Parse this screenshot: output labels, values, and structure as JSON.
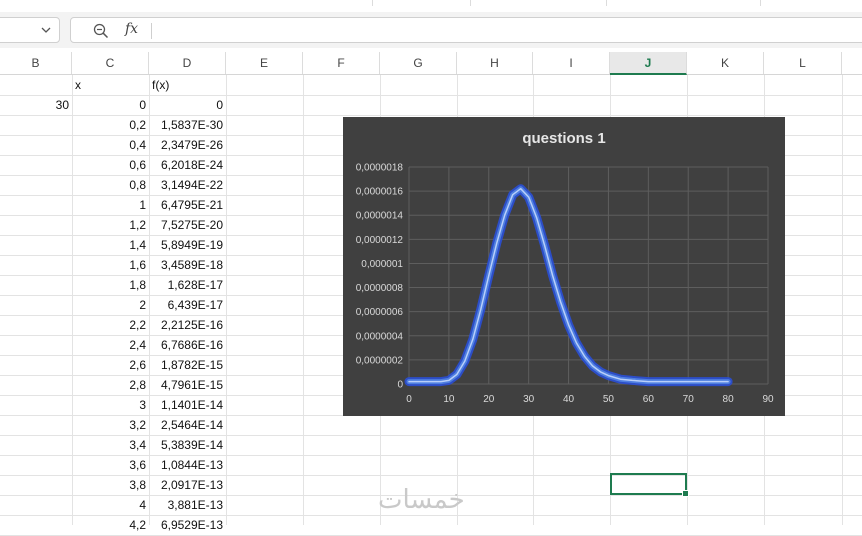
{
  "toolbar": {
    "name_box_value": "",
    "formula_value": "",
    "zoom_icon": "zoom-magnifier-icon",
    "fx_label": "fx"
  },
  "columns": [
    "B",
    "C",
    "D",
    "E",
    "F",
    "G",
    "H",
    "I",
    "J",
    "K",
    "L"
  ],
  "selected_column": "J",
  "headers": {
    "x": "x",
    "fx": "f(x)"
  },
  "b_value": "30",
  "rows": [
    {
      "x": "0",
      "fx": "0"
    },
    {
      "x": "0,2",
      "fx": "1,5837E-30"
    },
    {
      "x": "0,4",
      "fx": "2,3479E-26"
    },
    {
      "x": "0,6",
      "fx": "6,2018E-24"
    },
    {
      "x": "0,8",
      "fx": "3,1494E-22"
    },
    {
      "x": "1",
      "fx": "6,4795E-21"
    },
    {
      "x": "1,2",
      "fx": "7,5275E-20"
    },
    {
      "x": "1,4",
      "fx": "5,8949E-19"
    },
    {
      "x": "1,6",
      "fx": "3,4589E-18"
    },
    {
      "x": "1,8",
      "fx": "1,628E-17"
    },
    {
      "x": "2",
      "fx": "6,439E-17"
    },
    {
      "x": "2,2",
      "fx": "2,2125E-16"
    },
    {
      "x": "2,4",
      "fx": "6,7686E-16"
    },
    {
      "x": "2,6",
      "fx": "1,8782E-15"
    },
    {
      "x": "2,8",
      "fx": "4,7961E-15"
    },
    {
      "x": "3",
      "fx": "1,1401E-14"
    },
    {
      "x": "3,2",
      "fx": "2,5464E-14"
    },
    {
      "x": "3,4",
      "fx": "5,3839E-14"
    },
    {
      "x": "3,6",
      "fx": "1,0844E-13"
    },
    {
      "x": "3,8",
      "fx": "2,0917E-13"
    },
    {
      "x": "4",
      "fx": "3,881E-13"
    },
    {
      "x": "4,2",
      "fx": "6,9529E-13"
    }
  ],
  "watermark": "خمسات",
  "chart_data": {
    "type": "line",
    "title": "questions 1",
    "xlim": [
      0,
      90
    ],
    "ylim": [
      0,
      1.8e-06
    ],
    "x_ticks": [
      "0",
      "10",
      "20",
      "30",
      "40",
      "50",
      "60",
      "70",
      "80",
      "90"
    ],
    "y_ticks": [
      "0",
      "0,0000002",
      "0,0000004",
      "0,0000006",
      "0,0000008",
      "0,000001",
      "0,0000012",
      "0,0000014",
      "0,0000016",
      "0,0000018"
    ],
    "grid": true,
    "line_color": "#4f7fe0",
    "glow_color": "#2a4fd6",
    "series": [
      {
        "x": [
          0,
          5,
          8,
          10,
          12,
          14,
          16,
          18,
          20,
          22,
          24,
          26,
          28,
          30,
          32,
          34,
          36,
          38,
          40,
          42,
          44,
          46,
          48,
          50,
          53,
          56,
          60,
          65,
          70,
          75,
          80
        ],
        "y": [
          2e-08,
          2e-08,
          2e-08,
          3e-08,
          8e-08,
          1.9e-07,
          3.7e-07,
          6.2e-07,
          9e-07,
          1.17e-06,
          1.4e-06,
          1.57e-06,
          1.62e-06,
          1.55e-06,
          1.38e-06,
          1.15e-06,
          9e-07,
          6.8e-07,
          4.9e-07,
          3.4e-07,
          2.3e-07,
          1.5e-07,
          1e-07,
          7e-08,
          4e-08,
          3e-08,
          2e-08,
          2e-08,
          2e-08,
          2e-08,
          2e-08
        ]
      }
    ]
  }
}
